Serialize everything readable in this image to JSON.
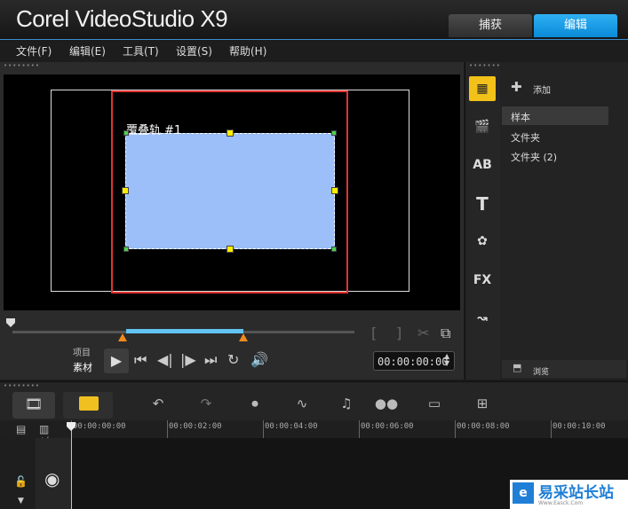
{
  "app": {
    "title": "Corel VideoStudio X9"
  },
  "tabs": [
    {
      "label": "捕获"
    },
    {
      "label": "编辑"
    }
  ],
  "menu": [
    {
      "label": "文件(F)"
    },
    {
      "label": "编辑(E)"
    },
    {
      "label": "工具(T)"
    },
    {
      "label": "设置(S)"
    },
    {
      "label": "帮助(H)"
    }
  ],
  "preview": {
    "overlay_label": "覆叠轨 #1",
    "overlay_color": "#9cbff9",
    "selection_color": "#e03232"
  },
  "player": {
    "mode_project": "项目",
    "mode_clip": "素材",
    "timecode": "00:00:00:00",
    "icons": [
      "play-icon",
      "goto-start-icon",
      "prev-frame-icon",
      "next-frame-icon",
      "goto-end-icon",
      "repeat-icon",
      "volume-icon",
      "mark-in-icon",
      "mark-out-icon",
      "split-icon",
      "enlarge-icon"
    ]
  },
  "library": {
    "add_label": "添加",
    "folders": [
      {
        "label": "样本"
      },
      {
        "label": "文件夹"
      },
      {
        "label": "文件夹 (2)"
      }
    ],
    "browse_label": "浏览",
    "icons": [
      "media-icon",
      "instant-project-icon",
      "transition-icon",
      "title-icon",
      "graphic-icon",
      "filter-icon",
      "path-icon"
    ]
  },
  "timeline": {
    "ruler": [
      "00:00:00:00",
      "00:00:02:00",
      "00:00:04:00",
      "00:00:06:00",
      "00:00:08:00",
      "00:00:10:00"
    ],
    "zoom_label": "+/−",
    "toolbar_icons": [
      "storyboard-view-icon",
      "timeline-view-icon",
      "undo-icon",
      "redo-icon",
      "record-capture-icon",
      "sound-mixer-icon",
      "auto-music-icon",
      "motion-tracking-icon",
      "subtitle-editor-icon",
      "multi-camera-icon"
    ]
  },
  "watermark": {
    "text": "易采站长站",
    "sub": "Www.Easck.Com"
  }
}
